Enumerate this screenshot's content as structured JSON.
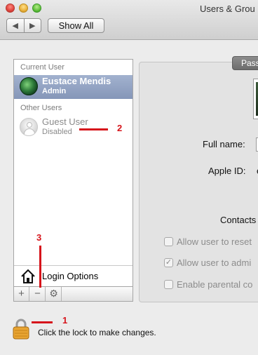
{
  "window": {
    "title": "Users & Grou",
    "nav_back": "◀",
    "nav_forward": "▶",
    "show_all": "Show All"
  },
  "user_list": {
    "current_header": "Current User",
    "current_user": {
      "name": "Eustace Mendis",
      "role": "Admin",
      "avatar_icon": "earth-avatar"
    },
    "other_header": "Other Users",
    "other_users": [
      {
        "name": "Guest User",
        "role": "Disabled",
        "avatar_icon": "guest-silhouette"
      }
    ],
    "login_options": "Login Options",
    "toolbar": {
      "add": "+",
      "remove": "−",
      "action": "⚙"
    }
  },
  "detail": {
    "tab_label": "Pass",
    "full_name_label": "Full name:",
    "apple_id_label": "Apple ID:",
    "apple_id_value": "e",
    "contacts_label": "Contacts",
    "options": [
      {
        "label": "Allow user to reset",
        "checked": false
      },
      {
        "label": "Allow user to admi",
        "checked": true
      },
      {
        "label": "Enable parental co",
        "checked": false
      }
    ]
  },
  "lock": {
    "text": "Click the lock to make changes.",
    "locked": false
  },
  "annotations": {
    "one": "1",
    "two": "2",
    "three": "3",
    "color": "#d6141b"
  }
}
